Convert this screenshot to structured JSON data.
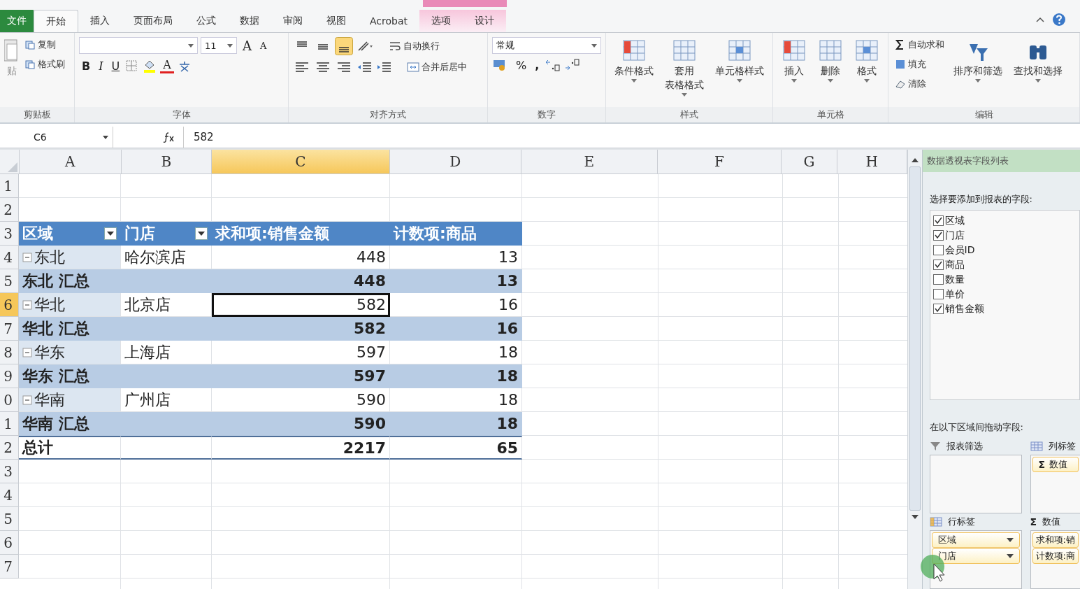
{
  "tabs": [
    {
      "label": "文件",
      "kind": "file",
      "selected": false
    },
    {
      "label": "开始",
      "kind": "normal",
      "selected": true
    },
    {
      "label": "插入",
      "kind": "normal",
      "selected": false
    },
    {
      "label": "页面布局",
      "kind": "normal",
      "selected": false
    },
    {
      "label": "公式",
      "kind": "normal",
      "selected": false
    },
    {
      "label": "数据",
      "kind": "normal",
      "selected": false
    },
    {
      "label": "审阅",
      "kind": "normal",
      "selected": false
    },
    {
      "label": "视图",
      "kind": "normal",
      "selected": false
    },
    {
      "label": "Acrobat",
      "kind": "normal",
      "selected": false
    },
    {
      "label": "选项",
      "kind": "context",
      "selected": false
    },
    {
      "label": "设计",
      "kind": "context",
      "selected": false
    }
  ],
  "ribbon": {
    "groups": [
      {
        "kind": "clipboard",
        "label": "剪贴板",
        "paste": "贴",
        "buttons": [
          "复制",
          "格式刷"
        ]
      },
      {
        "kind": "font",
        "label": "字体",
        "size": "11",
        "grow": "A",
        "shrink": "A",
        "bold": "B",
        "italic": "I",
        "underline": "U",
        "font_color": "A"
      },
      {
        "kind": "alignment",
        "label": "对齐方式",
        "valign": [
          {
            "selected": false
          },
          {
            "selected": false
          },
          {
            "selected": true
          }
        ],
        "wrap": "自动换行",
        "merge": "合并后居中"
      },
      {
        "kind": "number",
        "label": "数字",
        "format": "常规",
        "percent": "%",
        "comma": ","
      },
      {
        "kind": "large",
        "label": "样式",
        "buttons": [
          {
            "lines": [
              "条件格式"
            ]
          },
          {
            "lines": [
              "套用",
              "表格格式"
            ]
          },
          {
            "lines": [
              "单元格样式"
            ]
          }
        ]
      },
      {
        "kind": "large",
        "label": "单元格",
        "buttons": [
          {
            "lines": [
              "插入"
            ]
          },
          {
            "lines": [
              "删除"
            ]
          },
          {
            "lines": [
              "格式"
            ]
          }
        ]
      },
      {
        "kind": "editing",
        "label": "编辑",
        "small": [
          "自动求和",
          "填充",
          "清除"
        ],
        "large": [
          "排序和筛选",
          "查找和选择"
        ]
      }
    ]
  },
  "formula_bar": {
    "name_box": "C6",
    "value": "582"
  },
  "sheet": {
    "columns": [
      {
        "label": "A",
        "selected": false
      },
      {
        "label": "B",
        "selected": false
      },
      {
        "label": "C",
        "selected": true
      },
      {
        "label": "D",
        "selected": false
      },
      {
        "label": "E",
        "selected": false
      },
      {
        "label": "F",
        "selected": false
      },
      {
        "label": "G",
        "selected": false
      },
      {
        "label": "H",
        "selected": false
      }
    ],
    "rows": [
      {
        "number": "1",
        "selected": false,
        "kind": "blank",
        "cells": []
      },
      {
        "number": "2",
        "selected": false,
        "kind": "blank",
        "cells": []
      },
      {
        "number": "3",
        "selected": false,
        "kind": "header",
        "cells": [
          {
            "text": "区域",
            "filter": true,
            "selected": false
          },
          {
            "text": "门店",
            "filter": true,
            "selected": false
          },
          {
            "text": "求和项:销售金额",
            "filter": false,
            "selected": false
          },
          {
            "text": "计数项:商品",
            "filter": false,
            "selected": false
          }
        ]
      },
      {
        "number": "4",
        "selected": false,
        "kind": "item",
        "expanded": true,
        "cells": [
          {
            "text": "东北",
            "selected": false
          },
          {
            "text": "哈尔滨店",
            "selected": false
          },
          {
            "text": "448",
            "selected": false
          },
          {
            "text": "13",
            "selected": false
          }
        ]
      },
      {
        "number": "5",
        "selected": false,
        "kind": "subtotal",
        "cells": [
          {
            "text": "东北 汇总",
            "selected": false
          },
          {
            "text": "",
            "selected": false
          },
          {
            "text": "448",
            "selected": false
          },
          {
            "text": "13",
            "selected": false
          }
        ]
      },
      {
        "number": "6",
        "selected": true,
        "kind": "item",
        "expanded": true,
        "cells": [
          {
            "text": "华北",
            "selected": false
          },
          {
            "text": "北京店",
            "selected": false
          },
          {
            "text": "582",
            "selected": true
          },
          {
            "text": "16",
            "selected": false
          }
        ]
      },
      {
        "number": "7",
        "selected": false,
        "kind": "subtotal",
        "cells": [
          {
            "text": "华北 汇总",
            "selected": false
          },
          {
            "text": "",
            "selected": false
          },
          {
            "text": "582",
            "selected": false
          },
          {
            "text": "16",
            "selected": false
          }
        ]
      },
      {
        "number": "8",
        "selected": false,
        "kind": "item",
        "expanded": true,
        "cells": [
          {
            "text": "华东",
            "selected": false
          },
          {
            "text": "上海店",
            "selected": false
          },
          {
            "text": "597",
            "selected": false
          },
          {
            "text": "18",
            "selected": false
          }
        ]
      },
      {
        "number": "9",
        "selected": false,
        "kind": "subtotal",
        "cells": [
          {
            "text": "华东 汇总",
            "selected": false
          },
          {
            "text": "",
            "selected": false
          },
          {
            "text": "597",
            "selected": false
          },
          {
            "text": "18",
            "selected": false
          }
        ]
      },
      {
        "number": "0",
        "selected": false,
        "kind": "item",
        "expanded": true,
        "cells": [
          {
            "text": "华南",
            "selected": false
          },
          {
            "text": "广州店",
            "selected": false
          },
          {
            "text": "590",
            "selected": false
          },
          {
            "text": "18",
            "selected": false
          }
        ]
      },
      {
        "number": "1",
        "selected": false,
        "kind": "subtotal",
        "cells": [
          {
            "text": "华南 汇总",
            "selected": false
          },
          {
            "text": "",
            "selected": false
          },
          {
            "text": "590",
            "selected": false
          },
          {
            "text": "18",
            "selected": false
          }
        ]
      },
      {
        "number": "2",
        "selected": false,
        "kind": "total",
        "cells": [
          {
            "text": "总计",
            "selected": false
          },
          {
            "text": "",
            "selected": false
          },
          {
            "text": "2217",
            "selected": false
          },
          {
            "text": "65",
            "selected": false
          }
        ]
      },
      {
        "number": "3",
        "selected": false,
        "kind": "blank",
        "cells": []
      },
      {
        "number": "4",
        "selected": false,
        "kind": "blank",
        "cells": []
      },
      {
        "number": "5",
        "selected": false,
        "kind": "blank",
        "cells": []
      },
      {
        "number": "6",
        "selected": false,
        "kind": "blank",
        "cells": []
      },
      {
        "number": "7",
        "selected": false,
        "kind": "blank",
        "cells": []
      }
    ]
  },
  "field_list": {
    "title": "数据透视表字段列表",
    "prompt": "选择要添加到报表的字段:",
    "fields": [
      {
        "label": "区域",
        "checked": true
      },
      {
        "label": "门店",
        "checked": true
      },
      {
        "label": "会员ID",
        "checked": false
      },
      {
        "label": "商品",
        "checked": true
      },
      {
        "label": "数量",
        "checked": false
      },
      {
        "label": "单价",
        "checked": false
      },
      {
        "label": "销售金额",
        "checked": true
      }
    ],
    "areas_prompt": "在以下区域间拖动字段:",
    "areas": [
      {
        "kind": "filter",
        "label": "报表筛选"
      },
      {
        "kind": "columns",
        "label": "列标签",
        "items": [
          {
            "label": "数值",
            "sigma": "Σ"
          }
        ]
      },
      {
        "kind": "rows",
        "label": "行标签",
        "items": [
          {
            "label": "区域"
          },
          {
            "label": "门店"
          }
        ]
      },
      {
        "kind": "values",
        "label": "数值",
        "sigma": "Σ",
        "items": [
          {
            "label": "求和项:销"
          },
          {
            "label": "计数项:商"
          }
        ]
      }
    ]
  }
}
